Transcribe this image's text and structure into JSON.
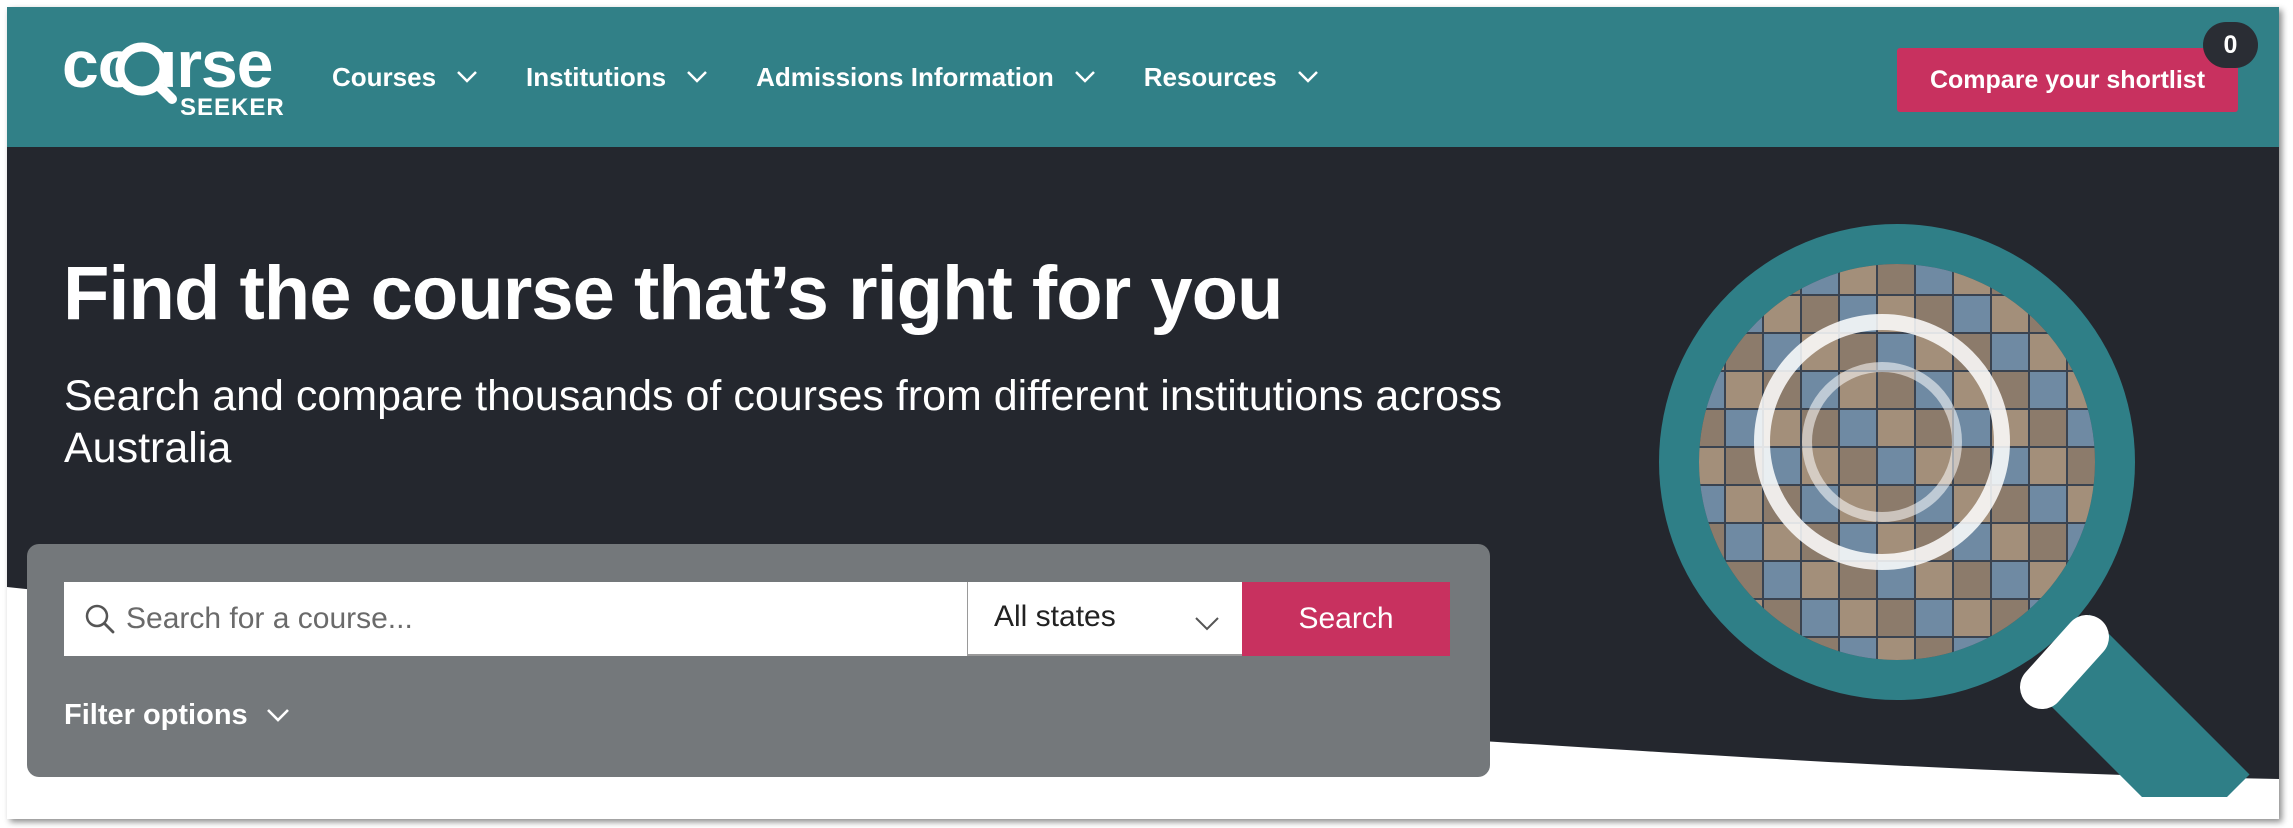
{
  "colors": {
    "nav_bg": "#318087",
    "hero_bg": "#24272e",
    "accent": "#c8315f",
    "panel_bg": "#74787b",
    "ring": "#2f7f87"
  },
  "logo": {
    "word": "course",
    "sub": "SEEKER",
    "icon": "magnifier-icon"
  },
  "nav": {
    "items": [
      {
        "label": "Courses",
        "icon": "chevron-down-icon"
      },
      {
        "label": "Institutions",
        "icon": "chevron-down-icon"
      },
      {
        "label": "Admissions Information",
        "icon": "chevron-down-icon"
      },
      {
        "label": "Resources",
        "icon": "chevron-down-icon"
      }
    ],
    "shortlist_button": "Compare your shortlist",
    "shortlist_count": "0"
  },
  "hero": {
    "title": "Find the course that’s right for you",
    "subtitle": "Search and compare thousands of courses from different institutions across Australia",
    "graphic_icon": "magnifying-glass-photo-collage-icon"
  },
  "search": {
    "placeholder": "Search for a course...",
    "value": "",
    "state_selected": "All states",
    "button": "Search",
    "filter_label": "Filter options"
  }
}
